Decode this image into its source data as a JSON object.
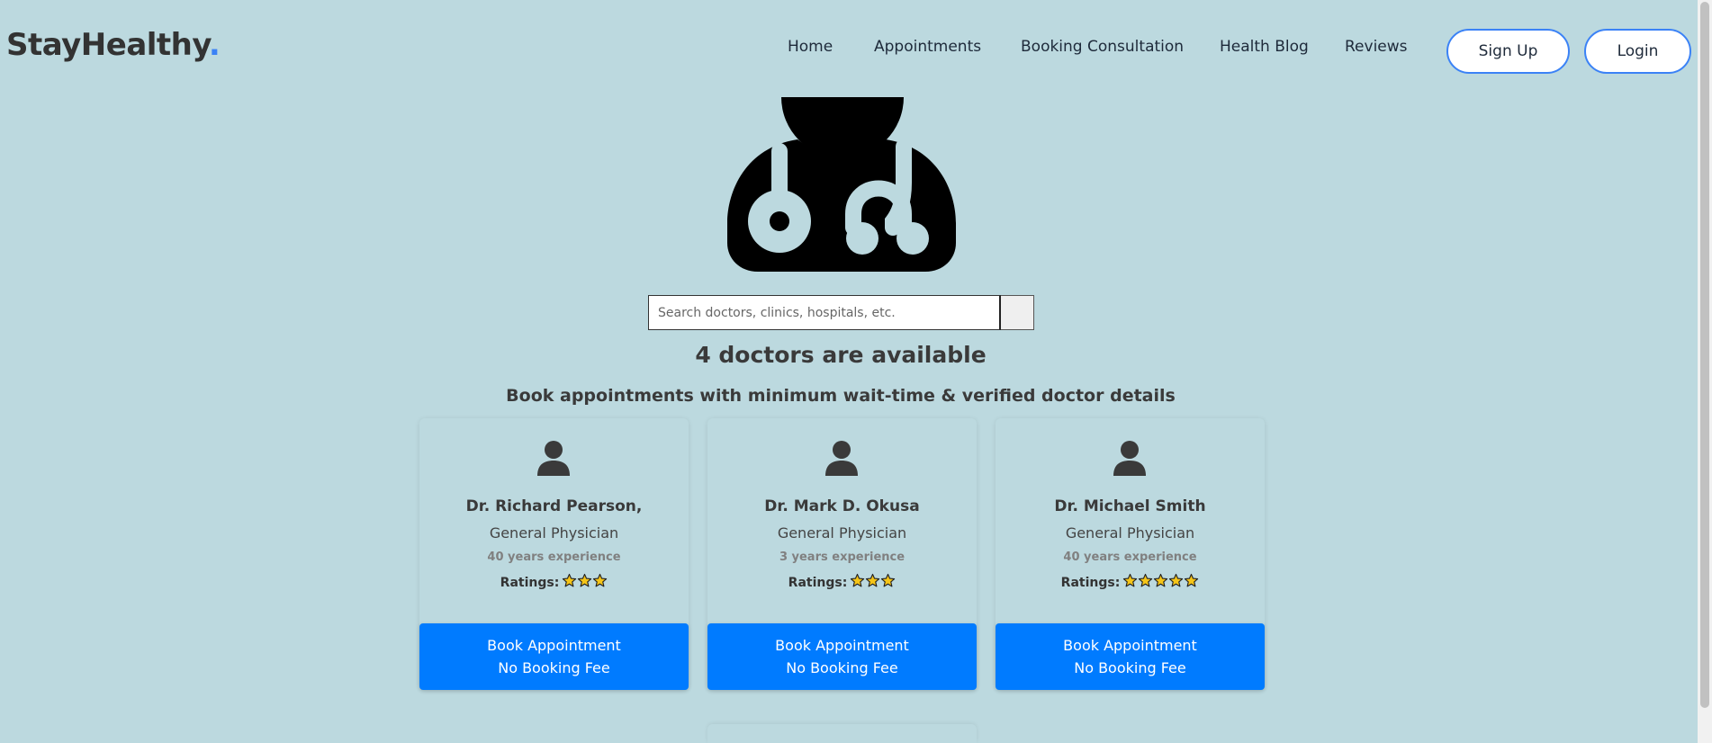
{
  "brand": {
    "name": "StayHealthy",
    "dot": ".",
    "accent": "#3b82f6"
  },
  "nav": {
    "links": [
      "Home",
      "Appointments",
      "Booking Consultation",
      "Health Blog",
      "Reviews"
    ],
    "signup_label": "Sign Up",
    "login_label": "Login"
  },
  "hero_icon": "doctor-stethoscope-icon",
  "search": {
    "placeholder": "Search doctors, clinics, hospitals, etc.",
    "value": ""
  },
  "heading": {
    "main": "4 doctors are available",
    "sub": "Book appointments with minimum wait-time & verified doctor details"
  },
  "ratings_label": "Ratings:",
  "doctors": [
    {
      "name": "Dr. Richard Pearson,",
      "speciality": "General Physician",
      "experience": "40 years experience",
      "stars": 3
    },
    {
      "name": "Dr. Mark D. Okusa",
      "speciality": "General Physician",
      "experience": "3 years experience",
      "stars": 3
    },
    {
      "name": "Dr. Michael Smith",
      "speciality": "General Physician",
      "experience": "40 years experience",
      "stars": 5
    }
  ],
  "book_button": {
    "line1": "Book Appointment",
    "line2": "No Booking Fee",
    "color": "#007bff"
  },
  "colors": {
    "background": "#bcd9df",
    "star_fill": "#f5c518"
  }
}
